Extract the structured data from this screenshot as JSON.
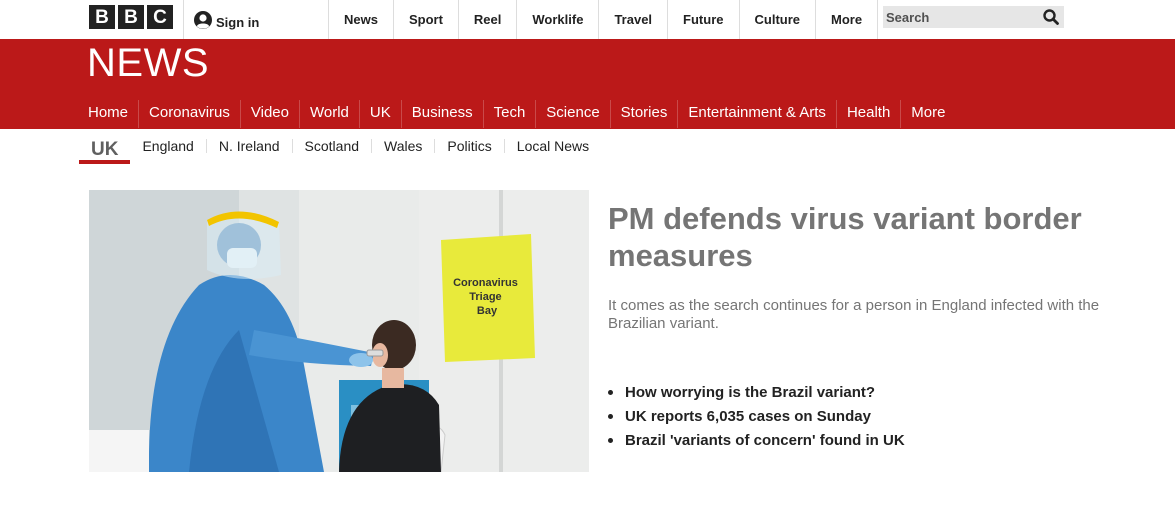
{
  "brand": {
    "letters": [
      "B",
      "B",
      "C"
    ]
  },
  "account": {
    "signin_label": "Sign in",
    "icon": "user-icon"
  },
  "topnav": [
    "News",
    "Sport",
    "Reel",
    "Worklife",
    "Travel",
    "Future",
    "Culture",
    "More"
  ],
  "search": {
    "placeholder": "Search",
    "icon": "search-icon"
  },
  "news": {
    "title": "NEWS",
    "nav": [
      "Home",
      "Coronavirus",
      "Video",
      "World",
      "UK",
      "Business",
      "Tech",
      "Science",
      "Stories",
      "Entertainment & Arts",
      "Health",
      "More"
    ]
  },
  "subnav": {
    "current": "UK",
    "items": [
      "England",
      "N. Ireland",
      "Scotland",
      "Wales",
      "Politics",
      "Local News"
    ]
  },
  "story": {
    "image_sign_text": "Coronavirus Triage Bay",
    "headline": "PM defends virus variant border measures",
    "summary": "It comes as the search continues for a person in England infected with the Brazilian variant.",
    "related": [
      "How worrying is the Brazil variant?",
      "UK reports 6,035 cases on Sunday",
      "Brazil 'variants of concern' found in UK"
    ]
  },
  "colors": {
    "news_red": "#bb1919",
    "headline_grey": "#757575"
  }
}
